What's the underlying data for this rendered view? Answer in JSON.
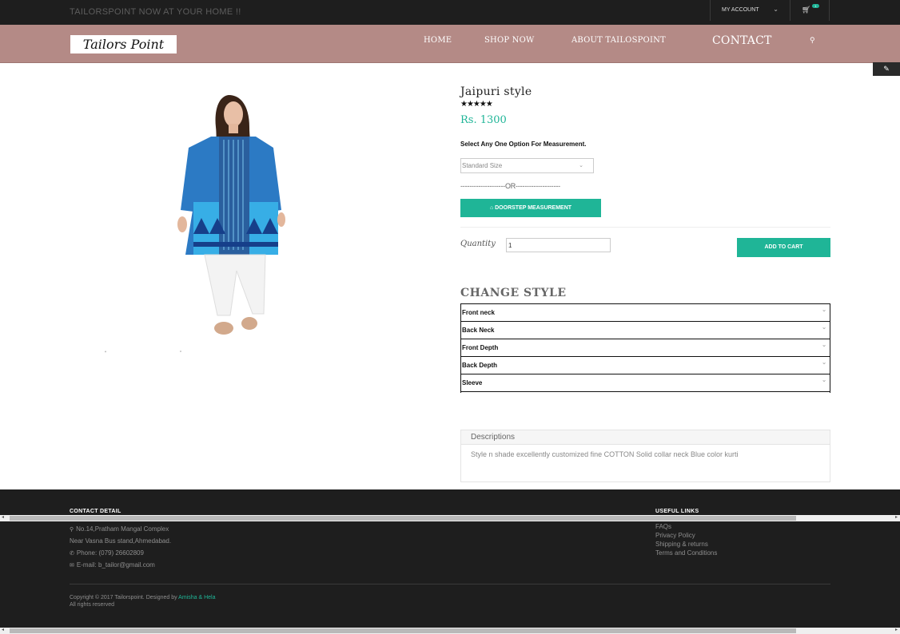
{
  "topbar": {
    "promo": "TAILORSPOINT NOW AT YOUR HOME !!",
    "account_label": "MY ACCOUNT",
    "cart_count": "1"
  },
  "header": {
    "logo": "Tailors Point",
    "nav": [
      "HOME",
      "SHOP NOW",
      "ABOUT TAILOSPOINT",
      "CONTACT"
    ]
  },
  "product": {
    "title": "Jaipuri style",
    "rating_stars": "★★★★★",
    "price": "Rs. 1300",
    "measure_label": "Select Any One Option For Measurement.",
    "size_selected": "Standard Size",
    "or_separator": "--------------------OR--------------------",
    "doorstep_label": "DOORSTEP MEASUREMENT",
    "quantity_label": "Quantity",
    "quantity_value": "1",
    "add_to_cart": "ADD TO CART",
    "image_caption_left": "“",
    "image_caption_right": "”"
  },
  "change_style": {
    "title": "CHANGE STYLE",
    "options": [
      "Front neck",
      "Back Neck",
      "Front Depth",
      "Back Depth",
      "Sleeve"
    ]
  },
  "description": {
    "heading": "Descriptions",
    "text": "Style n shade excellently customized fine COTTON Solid collar neck Blue color kurti"
  },
  "footer": {
    "contact_heading": "CONTACT DETAIL",
    "address_line1": "No.14,Pratham Mangal Complex",
    "address_line2": "Near Vasna Bus stand,Ahmedabad.",
    "phone": "Phone: (079) 26602809",
    "email": "E-mail: b_tailor@gmail.com",
    "links_heading": "USEFUL LINKS",
    "links": [
      "FAQs",
      "Privacy Policy",
      "Shipping & returns",
      "Terms and Conditions"
    ],
    "copyright_prefix": "Copyright © 2017 Tailorspoint. Designed by",
    "designers": "Amisha & Hela",
    "rights": "All rights reserved"
  },
  "colors": {
    "accent": "#1fb597",
    "header_bg": "#b48a86",
    "dark_bg": "#1e1e1e"
  }
}
